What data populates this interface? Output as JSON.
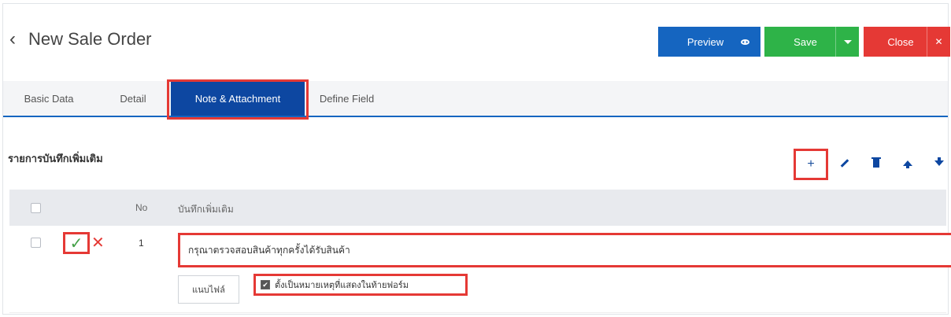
{
  "header": {
    "back_icon": "‹",
    "title": "New Sale Order",
    "preview_label": "Preview",
    "save_label": "Save",
    "close_label": "Close"
  },
  "tabs": [
    {
      "label": "Basic Data"
    },
    {
      "label": "Detail"
    },
    {
      "label": "Note & Attachment",
      "active": true
    },
    {
      "label": "Define Field"
    }
  ],
  "section": {
    "title": "รายการบันทึกเพิ่มเติม",
    "toolbar": {
      "add_label": "+"
    }
  },
  "table": {
    "headers": {
      "no": "No",
      "note": "บันทึกเพิ่มเติม"
    },
    "rows": [
      {
        "no": "1",
        "note_value": "กรุณาตรวจสอบสินค้าทุกครั้งได้รับสินค้า",
        "attach_label": "แนบไฟล์",
        "remark_label": "ตั้งเป็นหมายเหตุที่แสดงในท้ายฟอร์ม",
        "remark_checked": true
      }
    ]
  },
  "colors": {
    "preview": "#1565c0",
    "save": "#2eb348",
    "close": "#e53935",
    "active_tab": "#0d47a1",
    "highlight": "#e53935"
  },
  "icons": {
    "back": "chevron-left-icon",
    "preview": "eye-icon",
    "save_dropdown": "caret-down-icon",
    "close": "close-icon",
    "add": "plus-icon",
    "edit": "pencil-icon",
    "delete": "trash-icon",
    "move_up": "arrow-up-icon",
    "move_down": "arrow-down-icon",
    "confirm": "check-icon",
    "cancel": "x-icon"
  }
}
